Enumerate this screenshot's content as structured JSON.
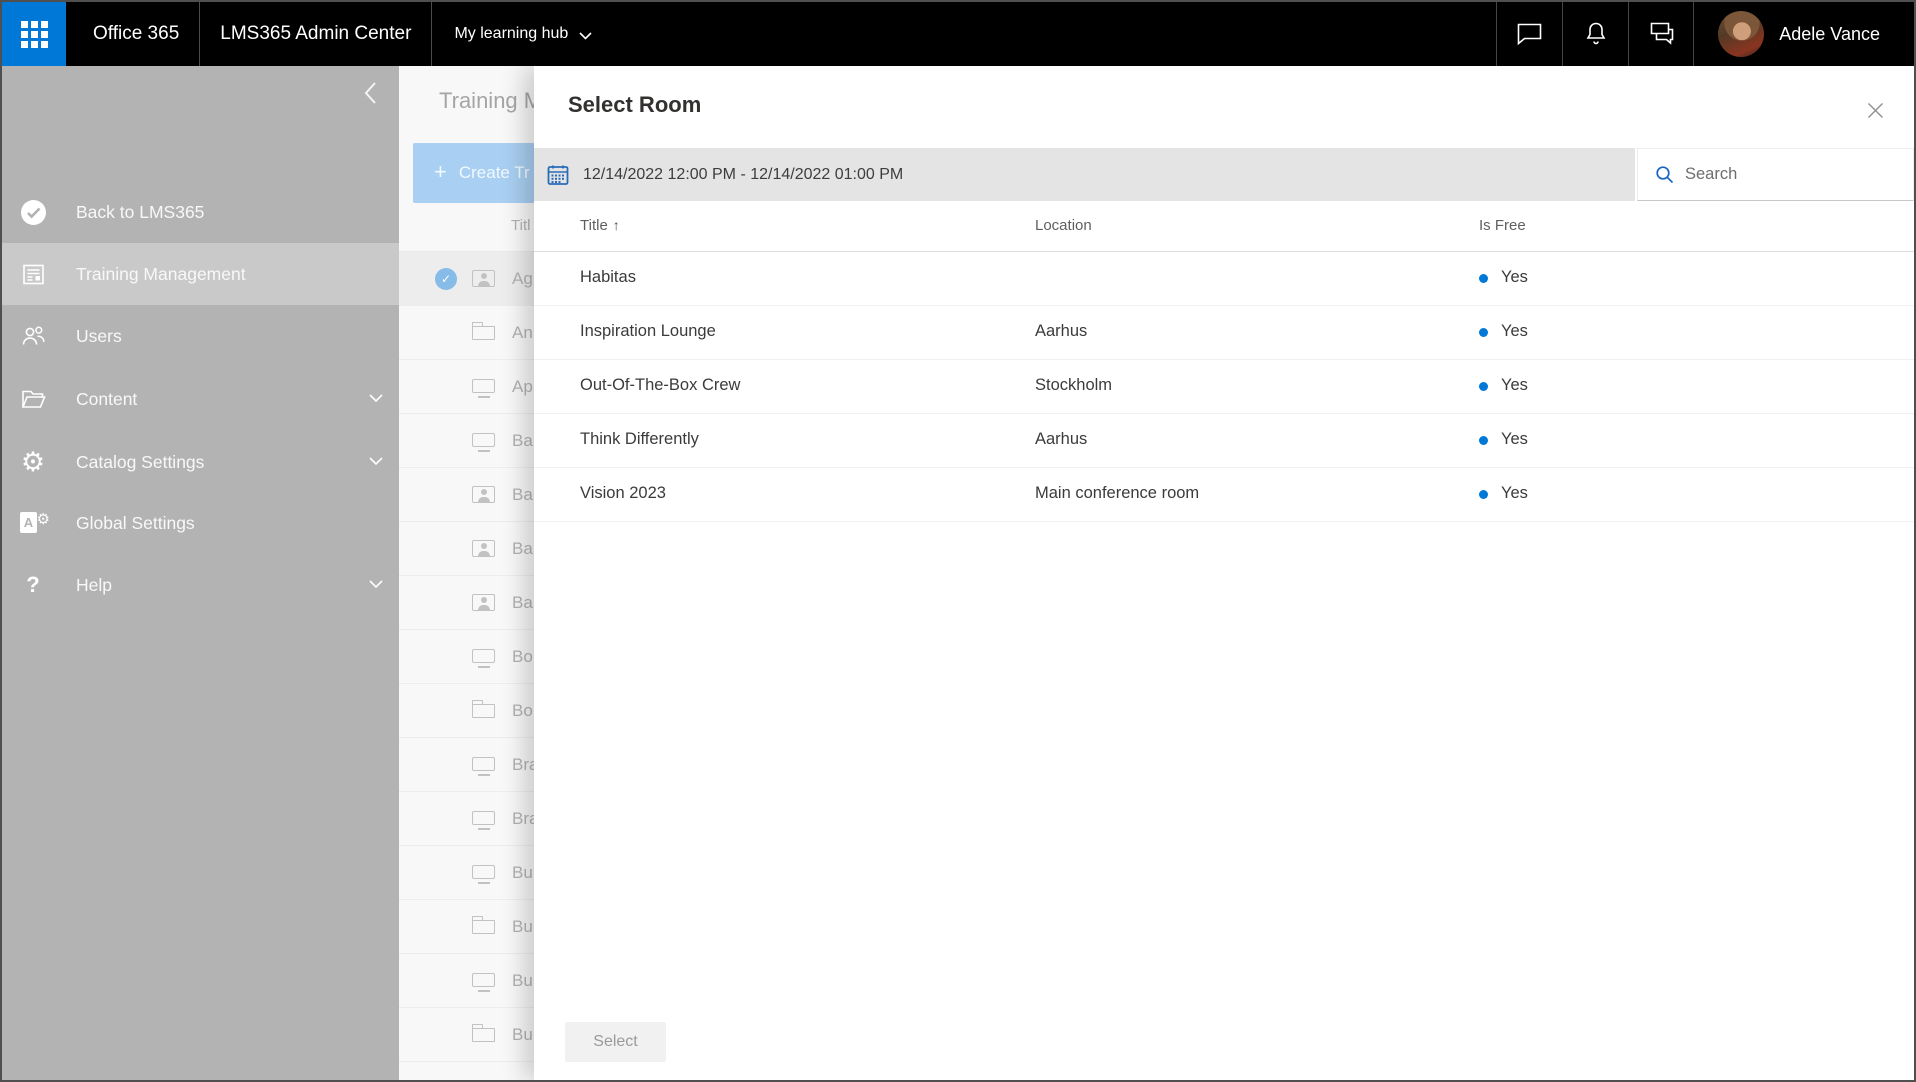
{
  "topbar": {
    "brand": "Office 365",
    "admin_center": "LMS365 Admin Center",
    "hub": "My learning hub",
    "user_name": "Adele Vance"
  },
  "sidebar": {
    "items": [
      {
        "label": "Back to LMS365"
      },
      {
        "label": "Training Management"
      },
      {
        "label": "Users"
      },
      {
        "label": "Content"
      },
      {
        "label": "Catalog Settings"
      },
      {
        "label": "Global Settings"
      },
      {
        "label": "Help"
      }
    ]
  },
  "background": {
    "page_title": "Training M",
    "create_button_label": "Create Tr",
    "create_button_plus": "+",
    "table_header_fragment": "Titl",
    "check_glyph": "✓",
    "rows": [
      {
        "icon": "person",
        "label": "Ag",
        "state": "selected"
      },
      {
        "icon": "folder",
        "label": "An",
        "state": ""
      },
      {
        "icon": "monitor",
        "label": "Ap",
        "state": ""
      },
      {
        "icon": "monitor",
        "label": "Ba",
        "state": ""
      },
      {
        "icon": "person",
        "label": "Ba",
        "state": ""
      },
      {
        "icon": "person",
        "label": "Ba",
        "state": ""
      },
      {
        "icon": "person",
        "label": "Ba",
        "state": ""
      },
      {
        "icon": "monitor",
        "label": "Bo",
        "state": ""
      },
      {
        "icon": "folder",
        "label": "Bo",
        "state": ""
      },
      {
        "icon": "monitor",
        "label": "Bra",
        "state": ""
      },
      {
        "icon": "monitor",
        "label": "Bra",
        "state": ""
      },
      {
        "icon": "monitor",
        "label": "Bu",
        "state": ""
      },
      {
        "icon": "folder",
        "label": "Bu",
        "state": ""
      },
      {
        "icon": "monitor",
        "label": "Bu",
        "state": ""
      },
      {
        "icon": "folder",
        "label": "Bu",
        "state": ""
      }
    ]
  },
  "modal": {
    "title": "Select Room",
    "date_range": "12/14/2022 12:00 PM - 12/14/2022 01:00 PM",
    "search_placeholder": "Search",
    "table": {
      "columns": [
        "Title",
        "Location",
        "Is Free"
      ],
      "sort_indicator": "↑",
      "rows": [
        {
          "title": "Habitas",
          "location": "",
          "is_free": "Yes"
        },
        {
          "title": "Inspiration Lounge",
          "location": "Aarhus",
          "is_free": "Yes"
        },
        {
          "title": "Out-Of-The-Box Crew",
          "location": "Stockholm",
          "is_free": "Yes"
        },
        {
          "title": "Think Differently",
          "location": "Aarhus",
          "is_free": "Yes"
        },
        {
          "title": "Vision 2023",
          "location": "Main conference room",
          "is_free": "Yes"
        }
      ]
    },
    "select_button": "Select"
  },
  "colors": {
    "accent": "#0078d7",
    "topbar_bg": "#000000",
    "waffle_bg": "#0078d7",
    "sidebar_bg": "#b3b3b3",
    "sidebar_active_bg": "#c9c9c9",
    "datebar_bg": "#e4e4e4",
    "calendar_icon": "#2a6cb8",
    "free_dot": "#0078d7",
    "create_button_bg": "#a9cff2"
  }
}
